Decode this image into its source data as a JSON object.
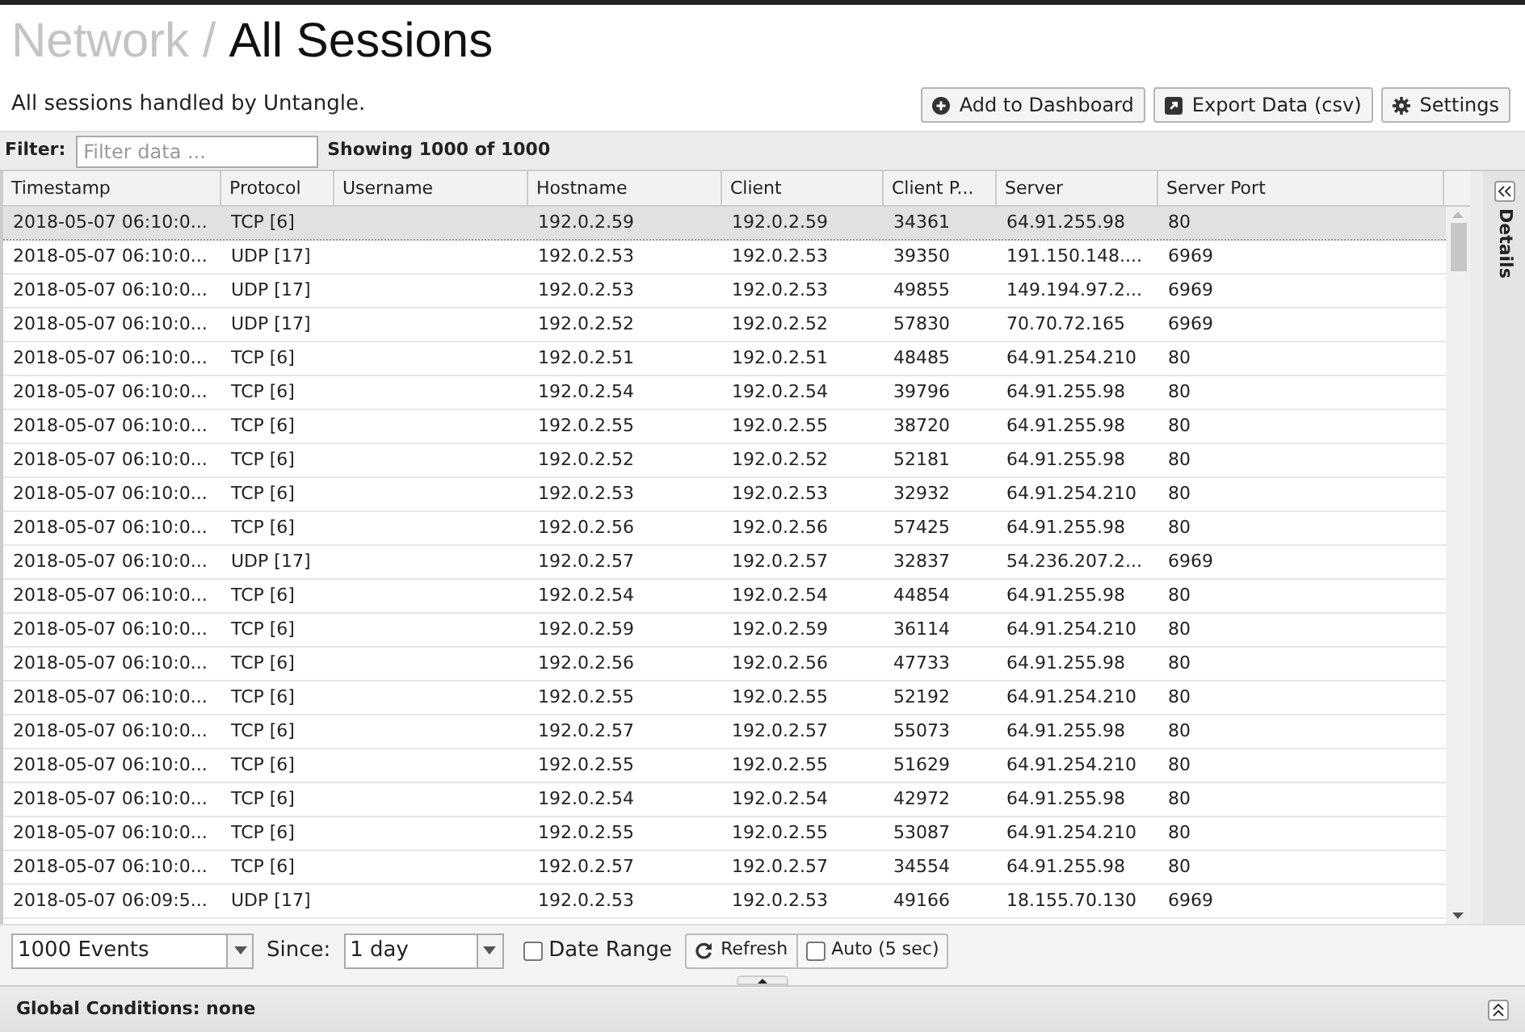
{
  "header": {
    "breadcrumb": "Network /",
    "title": "All Sessions"
  },
  "description": "All sessions handled by Untangle.",
  "actions": [
    {
      "label": "Add to Dashboard",
      "kind": "add"
    },
    {
      "label": "Export Data (csv)",
      "kind": "export"
    },
    {
      "label": "Settings",
      "kind": "settings"
    }
  ],
  "filter": {
    "label": "Filter:",
    "placeholder": "Filter data ...",
    "count": "Showing 1000 of 1000"
  },
  "table": {
    "columns": [
      "Timestamp",
      "Protocol",
      "Username",
      "Hostname",
      "Client",
      "Client P...",
      "Server",
      "Server Port"
    ],
    "rows": [
      {
        "selected": true,
        "timestamp": "2018-05-07 06:10:0...",
        "protocol": "TCP [6]",
        "hostname": "192.0.2.59",
        "client": "192.0.2.59",
        "client_port": "34361",
        "server": "64.91.255.98",
        "server_port": "80"
      },
      {
        "selected": false,
        "timestamp": "2018-05-07 06:10:0...",
        "protocol": "UDP [17]",
        "hostname": "192.0.2.53",
        "client": "192.0.2.53",
        "client_port": "39350",
        "server": "191.150.148....",
        "server_port": "6969"
      },
      {
        "selected": false,
        "timestamp": "2018-05-07 06:10:0...",
        "protocol": "UDP [17]",
        "hostname": "192.0.2.53",
        "client": "192.0.2.53",
        "client_port": "49855",
        "server": "149.194.97.2...",
        "server_port": "6969"
      },
      {
        "selected": false,
        "timestamp": "2018-05-07 06:10:0...",
        "protocol": "UDP [17]",
        "hostname": "192.0.2.52",
        "client": "192.0.2.52",
        "client_port": "57830",
        "server": "70.70.72.165",
        "server_port": "6969"
      },
      {
        "selected": false,
        "timestamp": "2018-05-07 06:10:0...",
        "protocol": "TCP [6]",
        "hostname": "192.0.2.51",
        "client": "192.0.2.51",
        "client_port": "48485",
        "server": "64.91.254.210",
        "server_port": "80"
      },
      {
        "selected": false,
        "timestamp": "2018-05-07 06:10:0...",
        "protocol": "TCP [6]",
        "hostname": "192.0.2.54",
        "client": "192.0.2.54",
        "client_port": "39796",
        "server": "64.91.255.98",
        "server_port": "80"
      },
      {
        "selected": false,
        "timestamp": "2018-05-07 06:10:0...",
        "protocol": "TCP [6]",
        "hostname": "192.0.2.55",
        "client": "192.0.2.55",
        "client_port": "38720",
        "server": "64.91.255.98",
        "server_port": "80"
      },
      {
        "selected": false,
        "timestamp": "2018-05-07 06:10:0...",
        "protocol": "TCP [6]",
        "hostname": "192.0.2.52",
        "client": "192.0.2.52",
        "client_port": "52181",
        "server": "64.91.255.98",
        "server_port": "80"
      },
      {
        "selected": false,
        "timestamp": "2018-05-07 06:10:0...",
        "protocol": "TCP [6]",
        "hostname": "192.0.2.53",
        "client": "192.0.2.53",
        "client_port": "32932",
        "server": "64.91.254.210",
        "server_port": "80"
      },
      {
        "selected": false,
        "timestamp": "2018-05-07 06:10:0...",
        "protocol": "TCP [6]",
        "hostname": "192.0.2.56",
        "client": "192.0.2.56",
        "client_port": "57425",
        "server": "64.91.255.98",
        "server_port": "80"
      },
      {
        "selected": false,
        "timestamp": "2018-05-07 06:10:0...",
        "protocol": "UDP [17]",
        "hostname": "192.0.2.57",
        "client": "192.0.2.57",
        "client_port": "32837",
        "server": "54.236.207.2...",
        "server_port": "6969"
      },
      {
        "selected": false,
        "timestamp": "2018-05-07 06:10:0...",
        "protocol": "TCP [6]",
        "hostname": "192.0.2.54",
        "client": "192.0.2.54",
        "client_port": "44854",
        "server": "64.91.255.98",
        "server_port": "80"
      },
      {
        "selected": false,
        "timestamp": "2018-05-07 06:10:0...",
        "protocol": "TCP [6]",
        "hostname": "192.0.2.59",
        "client": "192.0.2.59",
        "client_port": "36114",
        "server": "64.91.254.210",
        "server_port": "80"
      },
      {
        "selected": false,
        "timestamp": "2018-05-07 06:10:0...",
        "protocol": "TCP [6]",
        "hostname": "192.0.2.56",
        "client": "192.0.2.56",
        "client_port": "47733",
        "server": "64.91.255.98",
        "server_port": "80"
      },
      {
        "selected": false,
        "timestamp": "2018-05-07 06:10:0...",
        "protocol": "TCP [6]",
        "hostname": "192.0.2.55",
        "client": "192.0.2.55",
        "client_port": "52192",
        "server": "64.91.254.210",
        "server_port": "80"
      },
      {
        "selected": false,
        "timestamp": "2018-05-07 06:10:0...",
        "protocol": "TCP [6]",
        "hostname": "192.0.2.57",
        "client": "192.0.2.57",
        "client_port": "55073",
        "server": "64.91.255.98",
        "server_port": "80"
      },
      {
        "selected": false,
        "timestamp": "2018-05-07 06:10:0...",
        "protocol": "TCP [6]",
        "hostname": "192.0.2.55",
        "client": "192.0.2.55",
        "client_port": "51629",
        "server": "64.91.254.210",
        "server_port": "80"
      },
      {
        "selected": false,
        "timestamp": "2018-05-07 06:10:0...",
        "protocol": "TCP [6]",
        "hostname": "192.0.2.54",
        "client": "192.0.2.54",
        "client_port": "42972",
        "server": "64.91.255.98",
        "server_port": "80"
      },
      {
        "selected": false,
        "timestamp": "2018-05-07 06:10:0...",
        "protocol": "TCP [6]",
        "hostname": "192.0.2.55",
        "client": "192.0.2.55",
        "client_port": "53087",
        "server": "64.91.254.210",
        "server_port": "80"
      },
      {
        "selected": false,
        "timestamp": "2018-05-07 06:10:0...",
        "protocol": "TCP [6]",
        "hostname": "192.0.2.57",
        "client": "192.0.2.57",
        "client_port": "34554",
        "server": "64.91.255.98",
        "server_port": "80"
      },
      {
        "selected": false,
        "timestamp": "2018-05-07 06:09:5...",
        "protocol": "UDP [17]",
        "hostname": "192.0.2.53",
        "client": "192.0.2.53",
        "client_port": "49166",
        "server": "18.155.70.130",
        "server_port": "6969"
      }
    ]
  },
  "details_panel": {
    "label": "Details"
  },
  "toolbar": {
    "events": "1000 Events",
    "since_label": "Since:",
    "since": "1 day",
    "date_range": {
      "label": "Date Range",
      "checked": false
    },
    "refresh": "Refresh",
    "auto": {
      "label": "Auto (5 sec)",
      "checked": false
    }
  },
  "global_conditions": "Global Conditions: none"
}
